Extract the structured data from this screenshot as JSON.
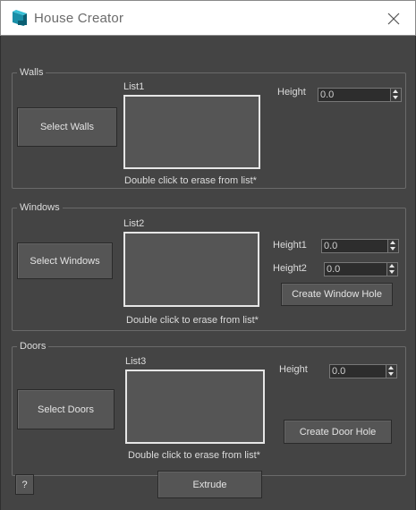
{
  "window": {
    "title": "House Creator",
    "icon": "3dsmax-app-icon",
    "close_icon": "close-icon"
  },
  "walls": {
    "group_title": "Walls",
    "select_button": "Select Walls",
    "list_label": "List1",
    "hint": "Double click to erase from list*",
    "height_label": "Height",
    "height_value": "0.0"
  },
  "windows": {
    "group_title": "Windows",
    "select_button": "Select Windows",
    "list_label": "List2",
    "hint": "Double click to erase from list*",
    "height1_label": "Height1",
    "height1_value": "0.0",
    "height2_label": "Height2",
    "height2_value": "0.0",
    "create_button": "Create Window Hole"
  },
  "doors": {
    "group_title": "Doors",
    "select_button": "Select Doors",
    "list_label": "List3",
    "hint": "Double click to erase from list*",
    "height_label": "Height",
    "height_value": "0.0",
    "create_button": "Create Door Hole"
  },
  "footer": {
    "help_button": "?",
    "extrude_button": "Extrude"
  },
  "colors": {
    "background": "#444444",
    "list_border": "#e6e6e6",
    "titlebar": "#ffffff"
  }
}
